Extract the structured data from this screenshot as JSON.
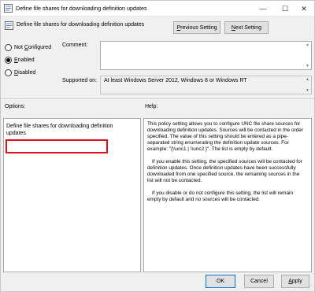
{
  "window": {
    "title": "Define file shares for downloading definition updates",
    "controls": {
      "minimize": "—",
      "maximize": "☐",
      "close": "✕"
    }
  },
  "header": {
    "policy_name": "Define file shares for downloading definition updates",
    "previous_setting": "Previous Setting",
    "previous_setting_accel": "P",
    "previous_setting_rest": "revious Setting",
    "next_setting_accel": "N",
    "next_setting_rest": "ext Setting"
  },
  "state": {
    "options": [
      {
        "accel": "C",
        "pre": "Not ",
        "post": "onfigured",
        "checked": false
      },
      {
        "accel": "E",
        "pre": "",
        "post": "nabled",
        "checked": true
      },
      {
        "accel": "D",
        "pre": "",
        "post": "isabled",
        "checked": false
      }
    ]
  },
  "comment": {
    "label": "Comment:",
    "value": ""
  },
  "supported_on": {
    "label": "Supported on:",
    "value": "At least Windows Server 2012, Windows 8 or Windows RT"
  },
  "options_section": {
    "label": "Options:",
    "field_label": "Define file shares for downloading definition updates",
    "field_value": ""
  },
  "help_section": {
    "label": "Help:",
    "paragraphs": [
      "This policy setting allows you to configure UNC file share sources for downloading definition updates. Sources will be contacted in the order specified. The value of this setting should be entered as a pipe-separated string enumerating the definition update sources. For example: \"{\\\\unc1 | \\\\unc2 }\". The list is empty by default.",
      "If you enable this setting, the specified sources will be contacted for definition updates. Once definition updates have been successfully downloaded from one specified source, the remaining sources in the list will not be contacted.",
      "If you disable or do not configure this setting, the list will remain empty by default and no sources will be contacted."
    ]
  },
  "footer": {
    "ok": "OK",
    "cancel": "Cancel",
    "apply_accel": "A",
    "apply_rest": "pply"
  },
  "colors": {
    "accent": "#0078d7",
    "highlight": "#d7141f",
    "background": "#f0f0f0"
  },
  "icons": [
    "policy-icon",
    "minimize-icon",
    "maximize-icon",
    "close-icon",
    "resize-grip-icon"
  ]
}
